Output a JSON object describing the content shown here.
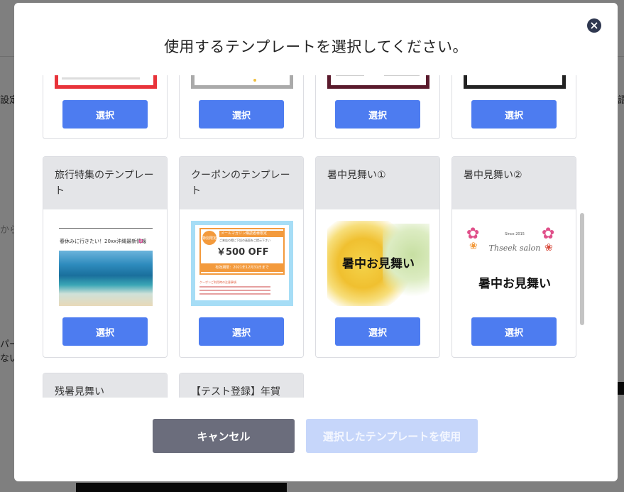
{
  "modal": {
    "title": "使用するテンプレートを選択してください。",
    "select_label": "選択",
    "cancel_label": "キャンセル",
    "use_label": "選択したテンプレートを使用"
  },
  "templates": [
    {
      "name": ""
    },
    {
      "name": ""
    },
    {
      "name": ""
    },
    {
      "name": ""
    },
    {
      "name": "旅行特集のテンプレート",
      "thumb_text": "春休みに行きたい！20xx沖縄最新情報"
    },
    {
      "name": "クーポンのテンプレート",
      "thumb_badge": "特別限定",
      "thumb_title": "メールマガジン購読者様限定",
      "thumb_sub": "ご来店の際に下記の画面をご提示下さい",
      "thumb_price": "￥500 OFF",
      "thumb_date": "有効期限：2021年12月31日まで",
      "thumb_note": "クーポンご利用時の注意事項"
    },
    {
      "name": "暑中見舞い①",
      "thumb_text": "暑中お見舞い"
    },
    {
      "name": "暑中見舞い②",
      "thumb_text": "暑中お見舞い",
      "thumb_since": "Since 2015",
      "thumb_script": "Thseek salon"
    },
    {
      "name": "残暑見舞い"
    },
    {
      "name": "【テスト登録】年賀"
    }
  ],
  "background": {
    "left_frag_1": "設定",
    "left_frag_2": "から",
    "left_frag_3": "パー",
    "left_frag_4": "ない",
    "right_frag_1": "語"
  },
  "colors": {
    "select_button": "#4d7cf0",
    "cancel_button": "#6b6d7c",
    "use_button_disabled": "#c6d6fa",
    "card_header": "#e4e5e8"
  }
}
